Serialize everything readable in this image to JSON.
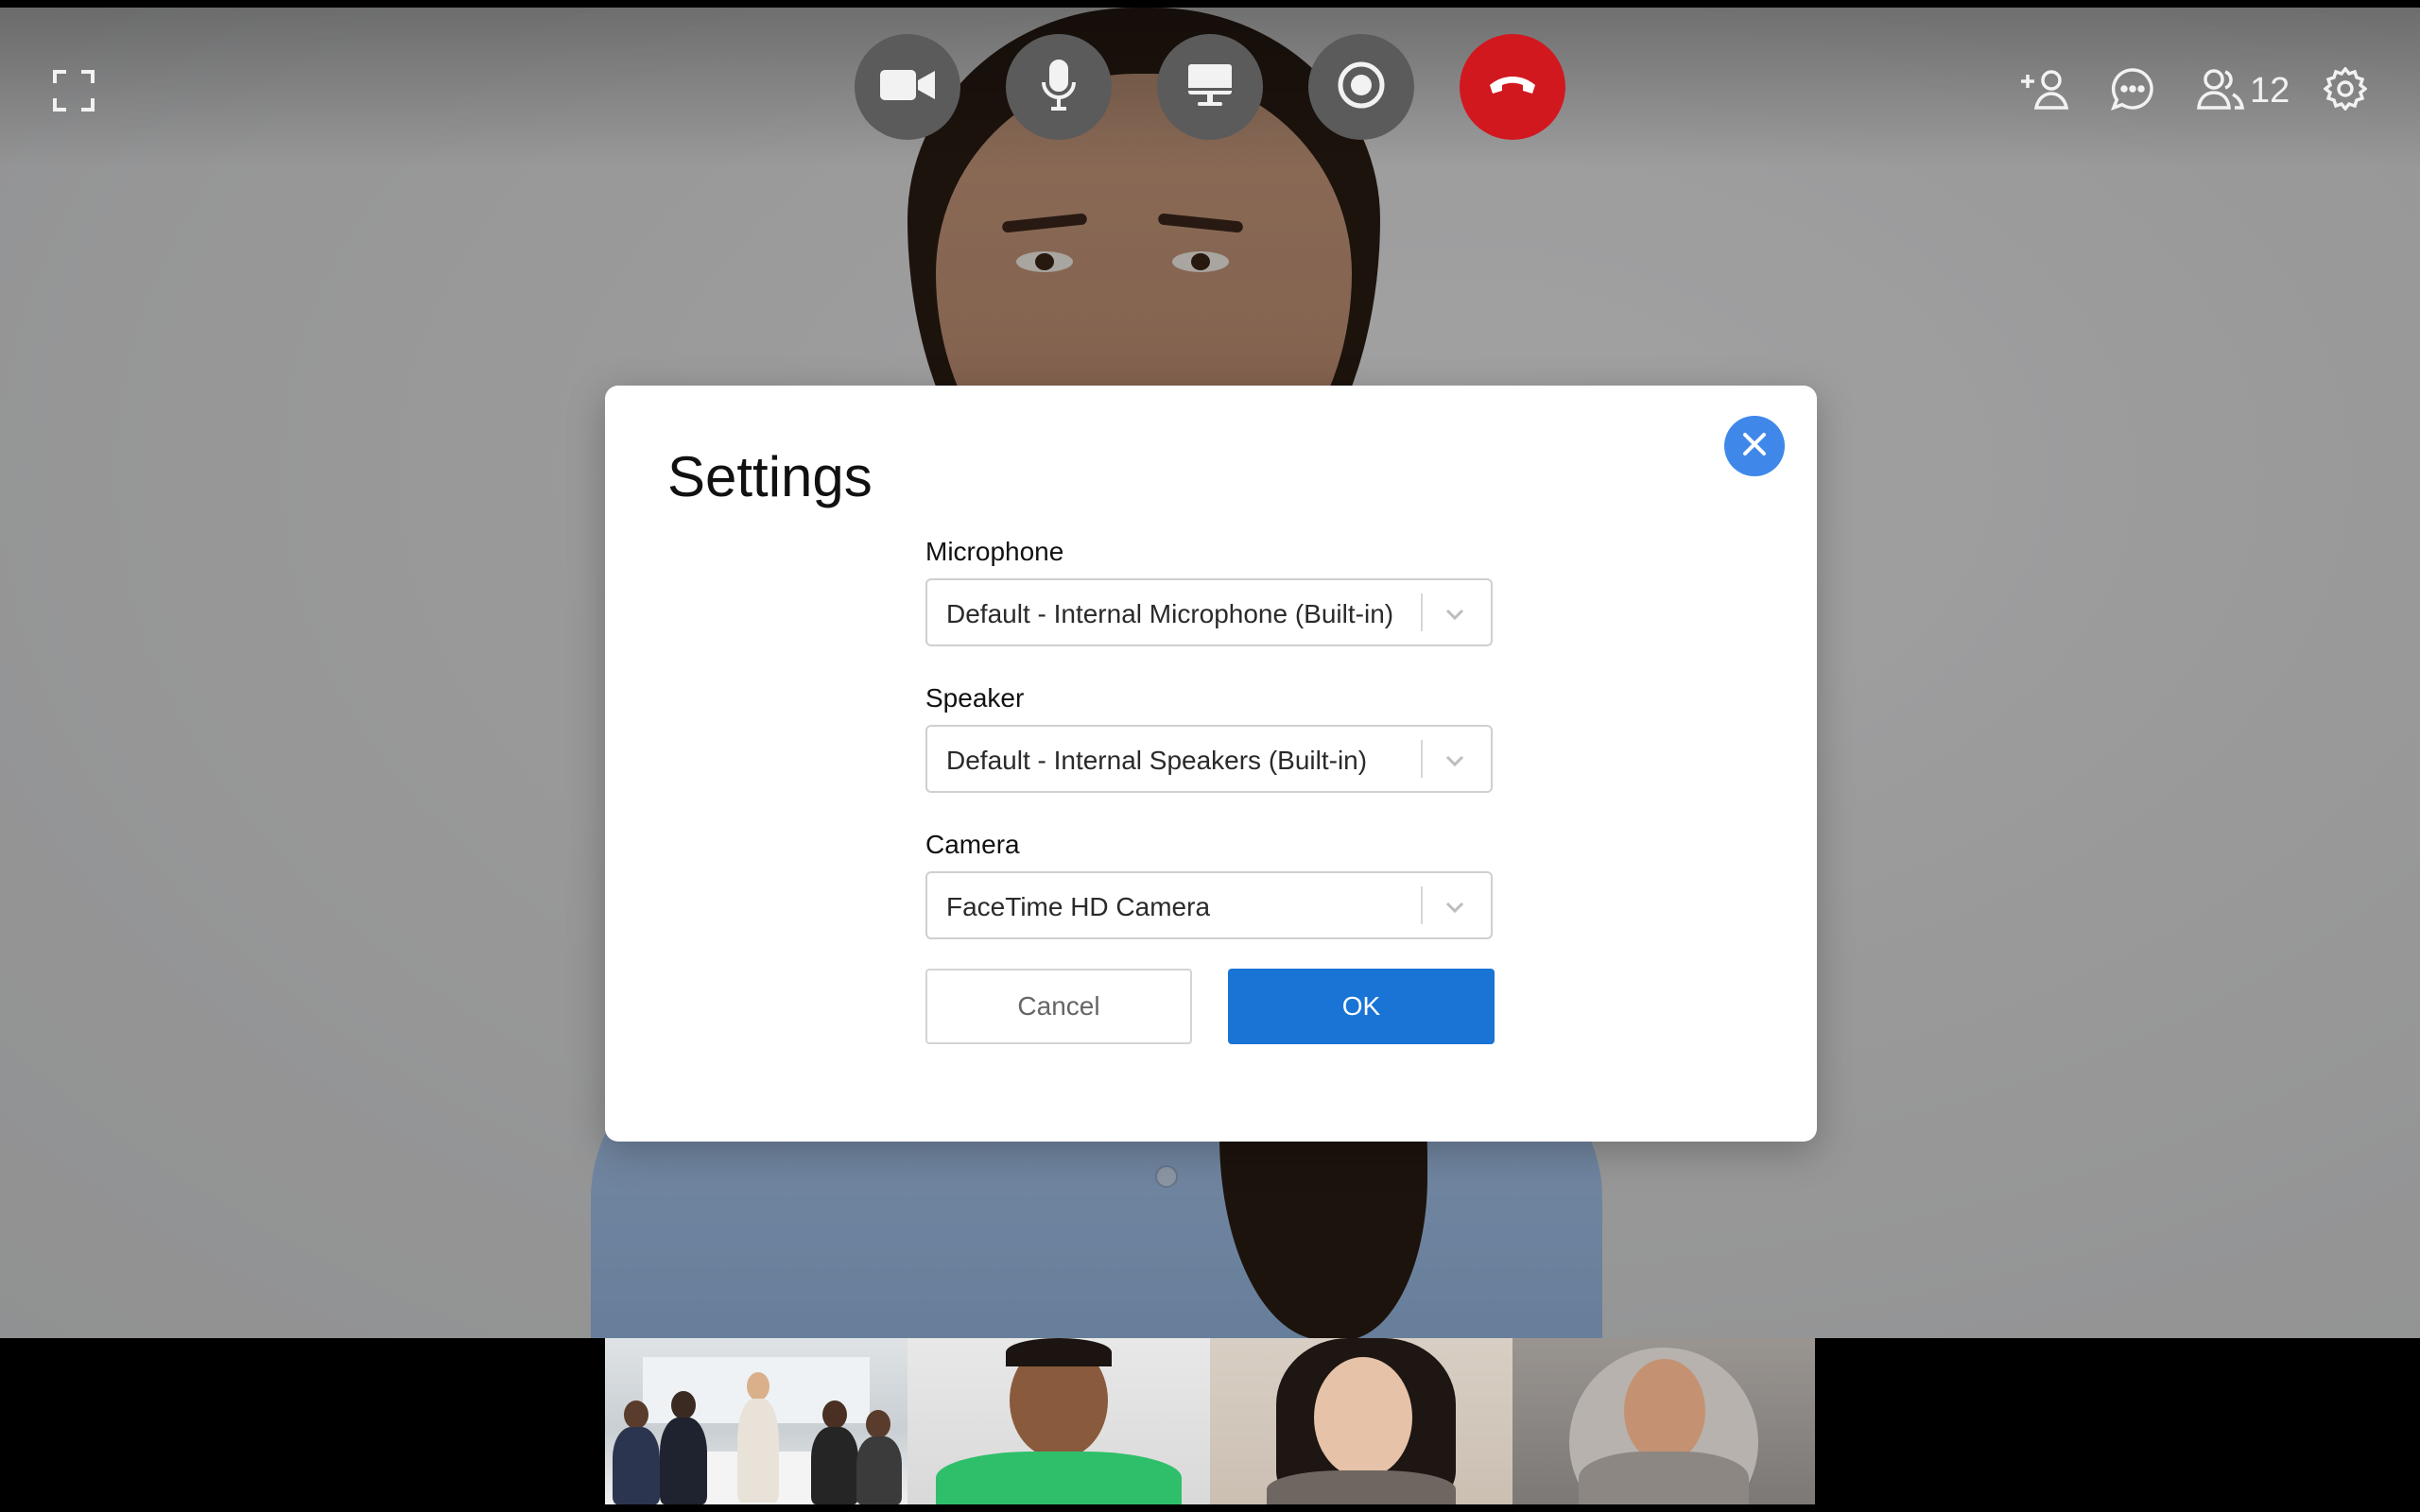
{
  "toolbar": {
    "participants_count": "12"
  },
  "settings_dialog": {
    "title": "Settings",
    "microphone": {
      "label": "Microphone",
      "value": "Default - Internal Microphone (Built-in)"
    },
    "speaker": {
      "label": "Speaker",
      "value": "Default - Internal Speakers (Built-in)"
    },
    "camera": {
      "label": "Camera",
      "value": "FaceTime HD Camera"
    },
    "cancel_label": "Cancel",
    "ok_label": "OK"
  },
  "colors": {
    "end_call": "#d2181f",
    "primary": "#1a74d6",
    "close_button": "#3f88ea",
    "control_button": "#5b5b5b"
  },
  "icons": {
    "fullscreen": "fullscreen-icon",
    "camera": "video-camera-icon",
    "mic": "microphone-icon",
    "screen": "screen-share-icon",
    "record": "record-icon",
    "hangup": "hang-up-icon",
    "add_person": "add-person-icon",
    "chat": "chat-icon",
    "participants": "participants-icon",
    "settings": "gear-icon",
    "close": "close-icon",
    "dropdown": "chevron-down-icon"
  }
}
